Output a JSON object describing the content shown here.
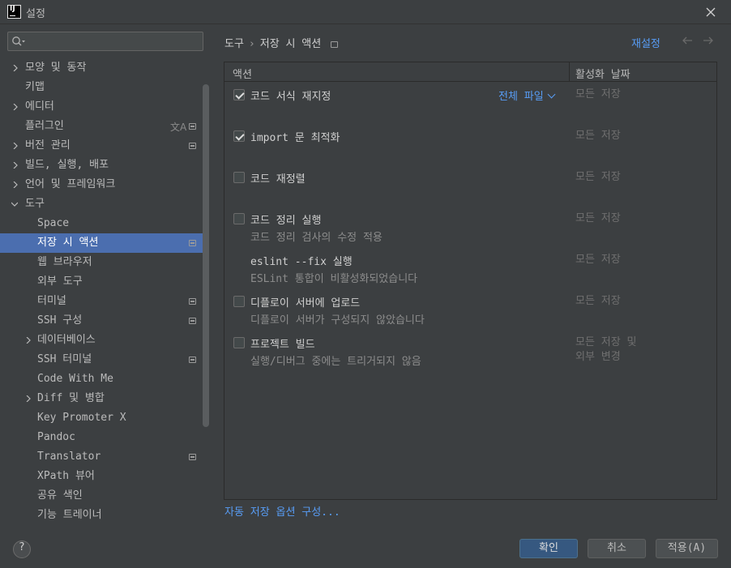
{
  "window": {
    "title": "설정"
  },
  "search": {
    "placeholder": "",
    "value": ""
  },
  "sidebar": {
    "items": [
      {
        "label": "모양 및 동작"
      },
      {
        "label": "키맵"
      },
      {
        "label": "에디터"
      },
      {
        "label": "플러그인"
      },
      {
        "label": "버전 관리"
      },
      {
        "label": "빌드, 실행, 배포"
      },
      {
        "label": "언어 및 프레임워크"
      },
      {
        "label": "도구"
      },
      {
        "label": "Space"
      },
      {
        "label": "저장 시 액션"
      },
      {
        "label": "웹 브라우저"
      },
      {
        "label": "외부 도구"
      },
      {
        "label": "터미널"
      },
      {
        "label": "SSH 구성"
      },
      {
        "label": "데이터베이스"
      },
      {
        "label": "SSH 터미널"
      },
      {
        "label": "Code With Me"
      },
      {
        "label": "Diff 및 병합"
      },
      {
        "label": "Key Promoter X"
      },
      {
        "label": "Pandoc"
      },
      {
        "label": "Translator"
      },
      {
        "label": "XPath 뷰어"
      },
      {
        "label": "공유 색인"
      },
      {
        "label": "기능 트레이너"
      }
    ]
  },
  "breadcrumb": {
    "parent": "도구",
    "separator": "›",
    "current": "저장 시 액션"
  },
  "reset_label": "재설정",
  "table": {
    "col_action": "액션",
    "col_when": "활성화 날짜",
    "rows": [
      {
        "title": "코드 서식 재지정",
        "subtitle": "",
        "when": "모든 저장",
        "scope": "전체 파일",
        "checked": true
      },
      {
        "title": "import 문 최적화",
        "subtitle": "",
        "when": "모든 저장",
        "checked": true
      },
      {
        "title": "코드 재정렬",
        "subtitle": "",
        "when": "모든 저장",
        "checked": false
      },
      {
        "title": "코드 정리 실행",
        "subtitle": "코드 정리 검사의 수정 적용",
        "when": "모든 저장",
        "checked": false
      },
      {
        "title": "eslint --fix 실행",
        "subtitle": "ESLint 통합이 비활성화되었습니다",
        "when": "모든 저장",
        "checked": null
      },
      {
        "title": "디플로이 서버에 업로드",
        "subtitle": "디플로이 서버가 구성되지 않았습니다",
        "when": "모든 저장",
        "checked": false
      },
      {
        "title": "프로젝트 빌드",
        "subtitle": "실행/디버그 중에는 트리거되지 않음",
        "when": "모든 저장 및",
        "when2": "외부 변경",
        "checked": false
      }
    ]
  },
  "config_link": "자동 저장 옵션 구성...",
  "footer": {
    "help": "?",
    "ok": "확인",
    "cancel": "취소",
    "apply": "적용(A)"
  },
  "colors": {
    "accent": "#589df6",
    "selection": "#4b6eaf",
    "primary_button": "#365880"
  }
}
